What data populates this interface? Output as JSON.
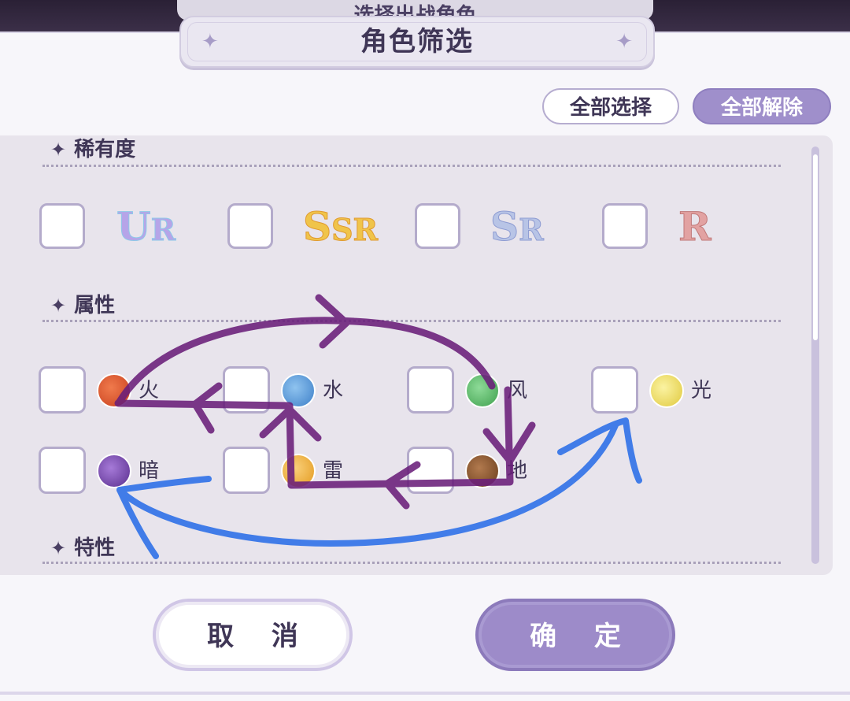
{
  "background": {
    "title": "选择出战角色"
  },
  "dialog": {
    "title": "角色筛选",
    "select_all_label": "全部选择",
    "clear_all_label": "全部解除"
  },
  "sections": {
    "rarity": {
      "label": "稀有度",
      "items": [
        "UR",
        "SSR",
        "SR",
        "R"
      ]
    },
    "attribute": {
      "label": "属性",
      "items": [
        {
          "label": "火",
          "icon": "fire-icon",
          "color": "#e0552e"
        },
        {
          "label": "水",
          "icon": "water-icon",
          "color": "#5a9fdc"
        },
        {
          "label": "风",
          "icon": "wind-icon",
          "color": "#5fbf6c"
        },
        {
          "label": "光",
          "icon": "light-icon",
          "color": "#f1e36a"
        },
        {
          "label": "暗",
          "icon": "dark-icon",
          "color": "#7a4fb0"
        },
        {
          "label": "雷",
          "icon": "thunder-icon",
          "color": "#f2b23a"
        },
        {
          "label": "地",
          "icon": "earth-icon",
          "color": "#8a5530"
        }
      ]
    },
    "trait": {
      "label": "特性"
    }
  },
  "footer": {
    "cancel_label": "取 消",
    "confirm_label": "确 定"
  },
  "colors": {
    "accent": "#9f8fcb",
    "annotation_purple": "#6a1f7a",
    "annotation_blue": "#2a6ee8"
  }
}
